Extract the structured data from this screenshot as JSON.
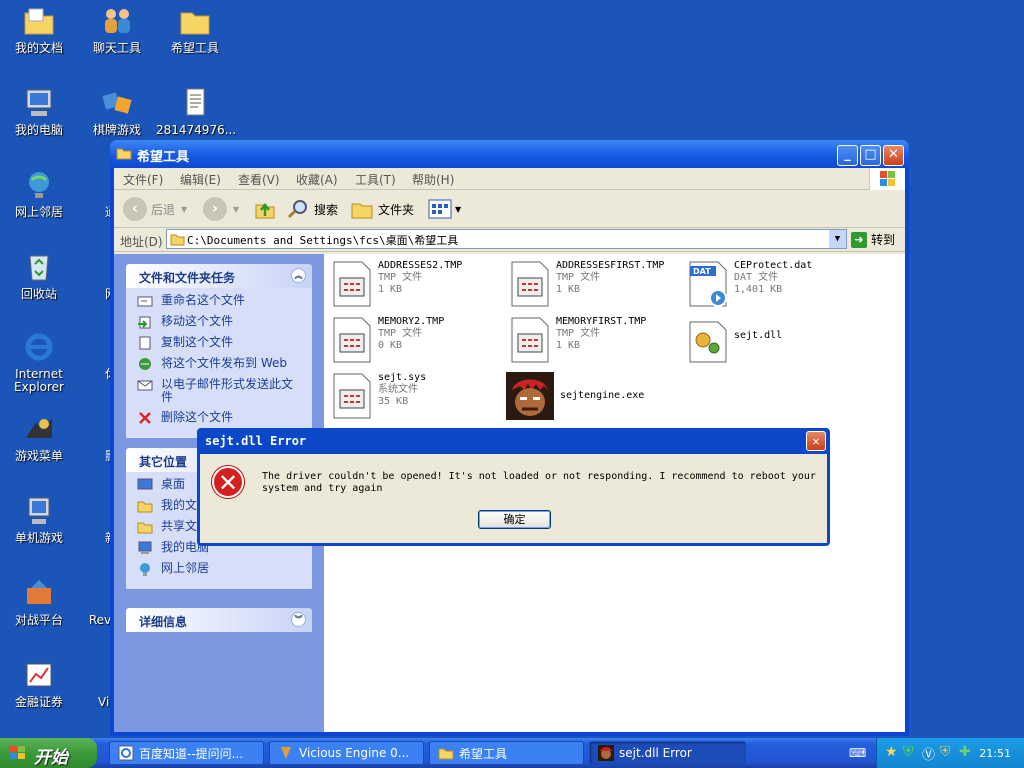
{
  "desktop": {
    "icons": [
      {
        "label": "我的文档"
      },
      {
        "label": "聊天工具"
      },
      {
        "label": "希望工具"
      },
      {
        "label": "我的电脑"
      },
      {
        "label": "棋牌游戏"
      },
      {
        "label": "281474976..."
      },
      {
        "label": "网上邻居"
      },
      {
        "label": "通信"
      },
      {
        "label": "回收站"
      },
      {
        "label": "网络"
      },
      {
        "label": "Internet Explorer"
      },
      {
        "label": "休闲"
      },
      {
        "label": "游戏菜单"
      },
      {
        "label": "影音"
      },
      {
        "label": "单机游戏"
      },
      {
        "label": "新建"
      },
      {
        "label": "对战平台"
      },
      {
        "label": "Revo Eng"
      },
      {
        "label": "金融证券"
      },
      {
        "label": "Vi Eng"
      }
    ]
  },
  "explorer": {
    "title": "希望工具",
    "menu": [
      "文件(F)",
      "编辑(E)",
      "查看(V)",
      "收藏(A)",
      "工具(T)",
      "帮助(H)"
    ],
    "toolbar": {
      "back": "后退",
      "search": "搜索",
      "folders": "文件夹"
    },
    "address": {
      "label": "地址(D)",
      "path": "C:\\Documents and Settings\\fcs\\桌面\\希望工具",
      "go": "转到"
    },
    "tasks": {
      "title": "文件和文件夹任务",
      "items": [
        "重命名这个文件",
        "移动这个文件",
        "复制这个文件",
        "将这个文件发布到 Web",
        "以电子邮件形式发送此文件",
        "删除这个文件"
      ]
    },
    "places": {
      "title": "其它位置",
      "items": [
        "桌面",
        "我的文",
        "共享文",
        "我的电脑",
        "网上邻居"
      ]
    },
    "details": {
      "title": "详细信息"
    },
    "files": [
      {
        "name": "ADDRESSES2.TMP",
        "type": "TMP 文件",
        "size": "1 KB"
      },
      {
        "name": "ADDRESSESFIRST.TMP",
        "type": "TMP 文件",
        "size": "1 KB"
      },
      {
        "name": "CEProtect.dat",
        "type": "DAT 文件",
        "size": "1,401 KB"
      },
      {
        "name": "MEMORY2.TMP",
        "type": "TMP 文件",
        "size": "0 KB"
      },
      {
        "name": "MEMORYFIRST.TMP",
        "type": "TMP 文件",
        "size": "1 KB"
      },
      {
        "name": "sejt.dll",
        "type": "",
        "size": ""
      },
      {
        "name": "sejt.sys",
        "type": "系统文件",
        "size": "35 KB"
      },
      {
        "name": "sejtengine.exe",
        "type": "",
        "size": ""
      }
    ]
  },
  "dialog": {
    "title": "sejt.dll Error",
    "message": "The driver couldn't be opened! It's not loaded or not responding. I recommend to reboot your system and try again",
    "ok": "确定"
  },
  "taskbar": {
    "start": "开始",
    "tasks": [
      "百度知道--提问问...",
      "Vicious Engine 0...",
      "希望工具",
      "sejt.dll Error"
    ],
    "clock": "21:51"
  }
}
